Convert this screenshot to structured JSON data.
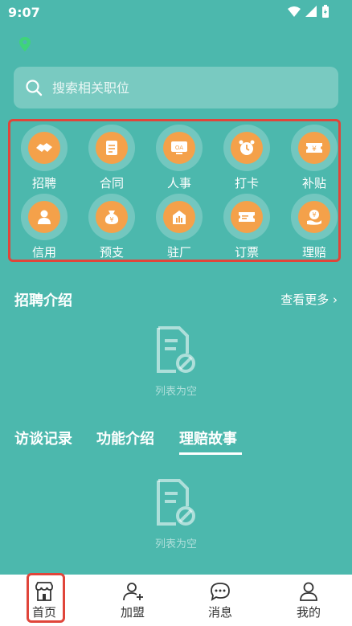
{
  "status": {
    "time": "9:07"
  },
  "search": {
    "placeholder": "搜索相关职位"
  },
  "features": [
    {
      "label": "招聘",
      "icon": "handshake-icon"
    },
    {
      "label": "合同",
      "icon": "document-icon"
    },
    {
      "label": "人事",
      "icon": "oa-icon"
    },
    {
      "label": "打卡",
      "icon": "alarm-clock-icon"
    },
    {
      "label": "补贴",
      "icon": "ticket-yen-icon"
    },
    {
      "label": "信用",
      "icon": "person-badge-icon"
    },
    {
      "label": "预支",
      "icon": "money-bag-icon"
    },
    {
      "label": "驻厂",
      "icon": "factory-icon"
    },
    {
      "label": "订票",
      "icon": "ticket-icon"
    },
    {
      "label": "理赔",
      "icon": "hand-coin-icon"
    }
  ],
  "recruit_section": {
    "title": "招聘介绍",
    "more": "查看更多",
    "empty": "列表为空"
  },
  "tabs": [
    {
      "label": "访谈记录",
      "active": false
    },
    {
      "label": "功能介绍",
      "active": false
    },
    {
      "label": "理赔故事",
      "active": true
    }
  ],
  "story_section": {
    "empty": "列表为空"
  },
  "nav": [
    {
      "label": "首页",
      "icon": "home-store-icon",
      "active": true
    },
    {
      "label": "加盟",
      "icon": "add-person-icon",
      "active": false
    },
    {
      "label": "消息",
      "icon": "chat-bubble-icon",
      "active": false
    },
    {
      "label": "我的",
      "icon": "person-icon",
      "active": false
    }
  ],
  "colors": {
    "background": "#4cb8ad",
    "accent": "#f4a14a",
    "highlight": "#e0453a"
  }
}
